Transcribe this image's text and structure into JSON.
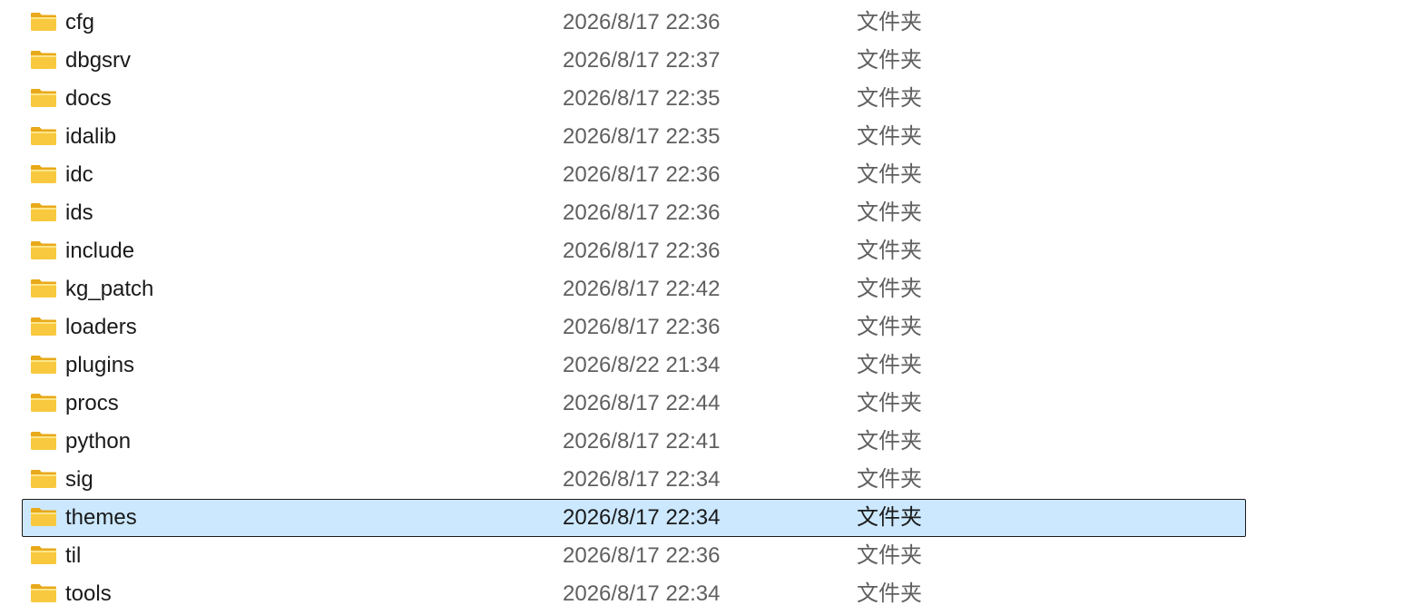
{
  "files": [
    {
      "name": "cfg",
      "modified": "2026/8/17 22:36",
      "type": "文件夹",
      "icon": "folder-icon",
      "selected": false
    },
    {
      "name": "dbgsrv",
      "modified": "2026/8/17 22:37",
      "type": "文件夹",
      "icon": "folder-icon",
      "selected": false
    },
    {
      "name": "docs",
      "modified": "2026/8/17 22:35",
      "type": "文件夹",
      "icon": "folder-icon",
      "selected": false
    },
    {
      "name": "idalib",
      "modified": "2026/8/17 22:35",
      "type": "文件夹",
      "icon": "folder-icon",
      "selected": false
    },
    {
      "name": "idc",
      "modified": "2026/8/17 22:36",
      "type": "文件夹",
      "icon": "folder-icon",
      "selected": false
    },
    {
      "name": "ids",
      "modified": "2026/8/17 22:36",
      "type": "文件夹",
      "icon": "folder-icon",
      "selected": false
    },
    {
      "name": "include",
      "modified": "2026/8/17 22:36",
      "type": "文件夹",
      "icon": "folder-icon",
      "selected": false
    },
    {
      "name": "kg_patch",
      "modified": "2026/8/17 22:42",
      "type": "文件夹",
      "icon": "folder-icon",
      "selected": false
    },
    {
      "name": "loaders",
      "modified": "2026/8/17 22:36",
      "type": "文件夹",
      "icon": "folder-icon",
      "selected": false
    },
    {
      "name": "plugins",
      "modified": "2026/8/22 21:34",
      "type": "文件夹",
      "icon": "folder-icon",
      "selected": false
    },
    {
      "name": "procs",
      "modified": "2026/8/17 22:44",
      "type": "文件夹",
      "icon": "folder-icon",
      "selected": false
    },
    {
      "name": "python",
      "modified": "2026/8/17 22:41",
      "type": "文件夹",
      "icon": "folder-icon",
      "selected": false
    },
    {
      "name": "sig",
      "modified": "2026/8/17 22:34",
      "type": "文件夹",
      "icon": "folder-icon",
      "selected": false
    },
    {
      "name": "themes",
      "modified": "2026/8/17 22:34",
      "type": "文件夹",
      "icon": "folder-icon",
      "selected": true
    },
    {
      "name": "til",
      "modified": "2026/8/17 22:36",
      "type": "文件夹",
      "icon": "folder-icon",
      "selected": false
    },
    {
      "name": "tools",
      "modified": "2026/8/17 22:34",
      "type": "文件夹",
      "icon": "folder-icon",
      "selected": false
    }
  ],
  "colors": {
    "selected_background": "#cce8ff",
    "selected_border": "#1a1a1a",
    "folder_body": "#f8c93f",
    "folder_tab": "#e8a91a",
    "secondary_text": "#5f5f5f"
  }
}
